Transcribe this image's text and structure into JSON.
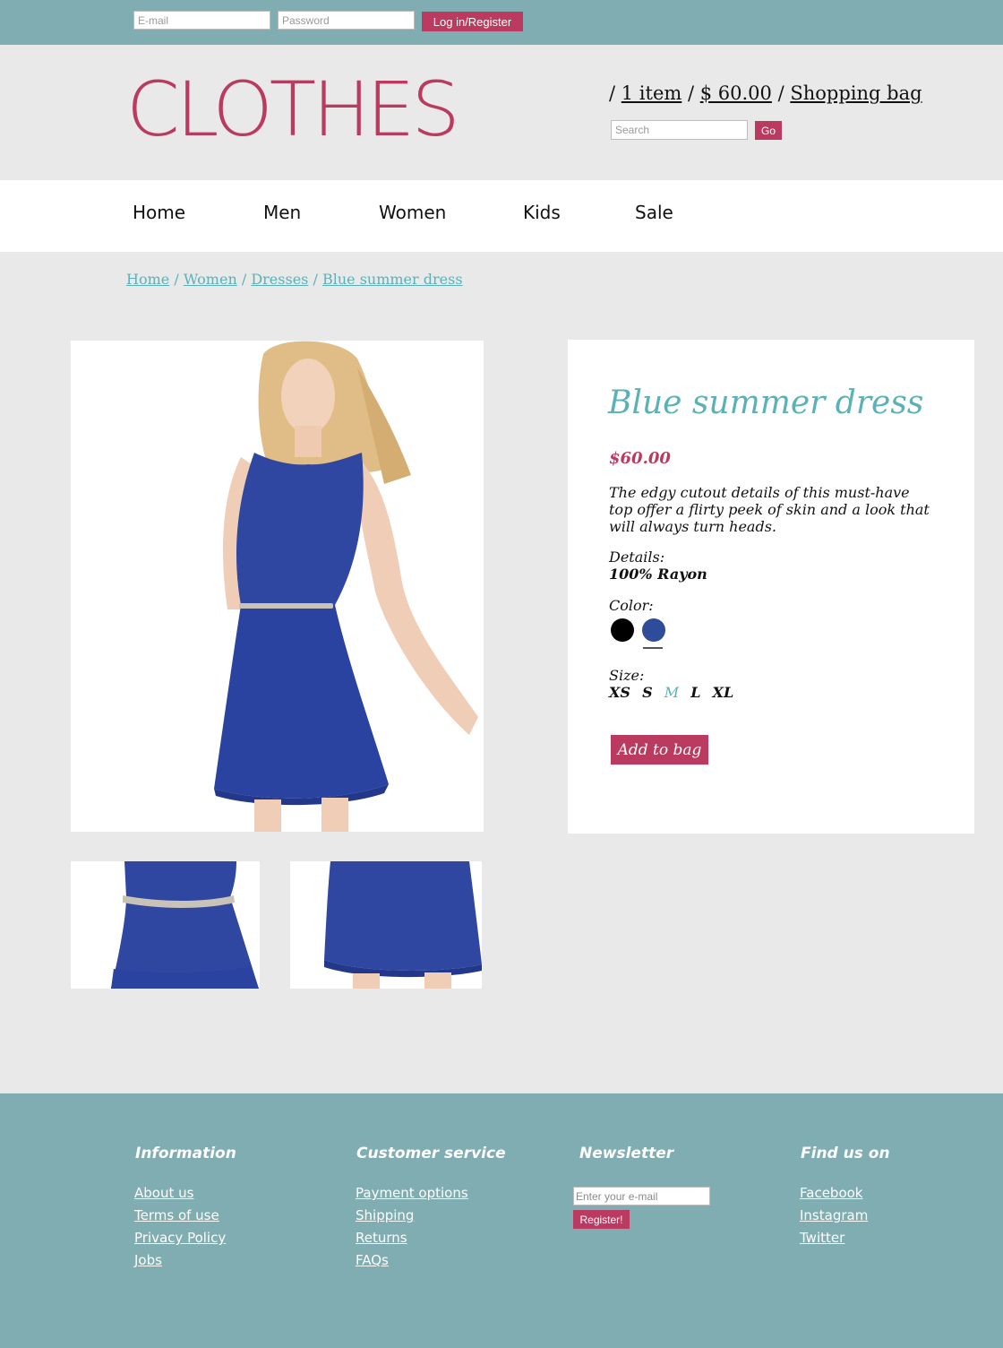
{
  "topbar": {
    "email_placeholder": "E-mail",
    "password_placeholder": "Password",
    "login_label": "Log in/Register"
  },
  "header": {
    "logo": "CLOTHES",
    "cart": {
      "sep1": "/ ",
      "items_label": "1 item",
      "sep2": " / ",
      "total_label": "$ 60.00",
      "sep3": " / ",
      "bag_label": "Shopping bag"
    },
    "search_placeholder": "Search",
    "go_label": "Go"
  },
  "nav": {
    "items": [
      {
        "label": "Home"
      },
      {
        "label": "Men"
      },
      {
        "label": "Women"
      },
      {
        "label": "Kids"
      },
      {
        "label": "Sale"
      }
    ]
  },
  "breadcrumb": {
    "items": [
      "Home",
      "Women",
      "Dresses",
      "Blue summer dress"
    ],
    "separator": "/"
  },
  "product": {
    "title": "Blue summer dress",
    "price": "$60.00",
    "description": "The edgy cutout details of this must-have top offer a flirty peek of skin and a look that will always turn heads.",
    "details_label": "Details:",
    "details_value": "100% Rayon",
    "color_label": "Color:",
    "colors": [
      {
        "name": "black",
        "hex": "#000000"
      },
      {
        "name": "blue",
        "hex": "#2f4c9a",
        "selected": true
      }
    ],
    "size_label": "Size:",
    "sizes": [
      "XS",
      "S",
      "M",
      "L",
      "XL"
    ],
    "selected_size": "M",
    "add_label": "Add to bag"
  },
  "footer": {
    "information": {
      "title": "Information",
      "links": [
        "About us",
        "Terms of use",
        "Privacy Policy",
        "Jobs"
      ]
    },
    "customer_service": {
      "title": "Customer service",
      "links": [
        "Payment options",
        "Shipping",
        "Returns",
        "FAQs"
      ]
    },
    "newsletter": {
      "title": "Newsletter",
      "placeholder": "Enter your e-mail",
      "register_label": "Register!"
    },
    "find_us": {
      "title": "Find us on",
      "links": [
        "Facebook",
        "Instagram",
        "Twitter"
      ]
    }
  },
  "colors": {
    "accent_pink": "#bb3b60",
    "accent_teal": "#5bb1b8",
    "bar_teal": "#7fadb1",
    "background": "#e9e9e9"
  }
}
